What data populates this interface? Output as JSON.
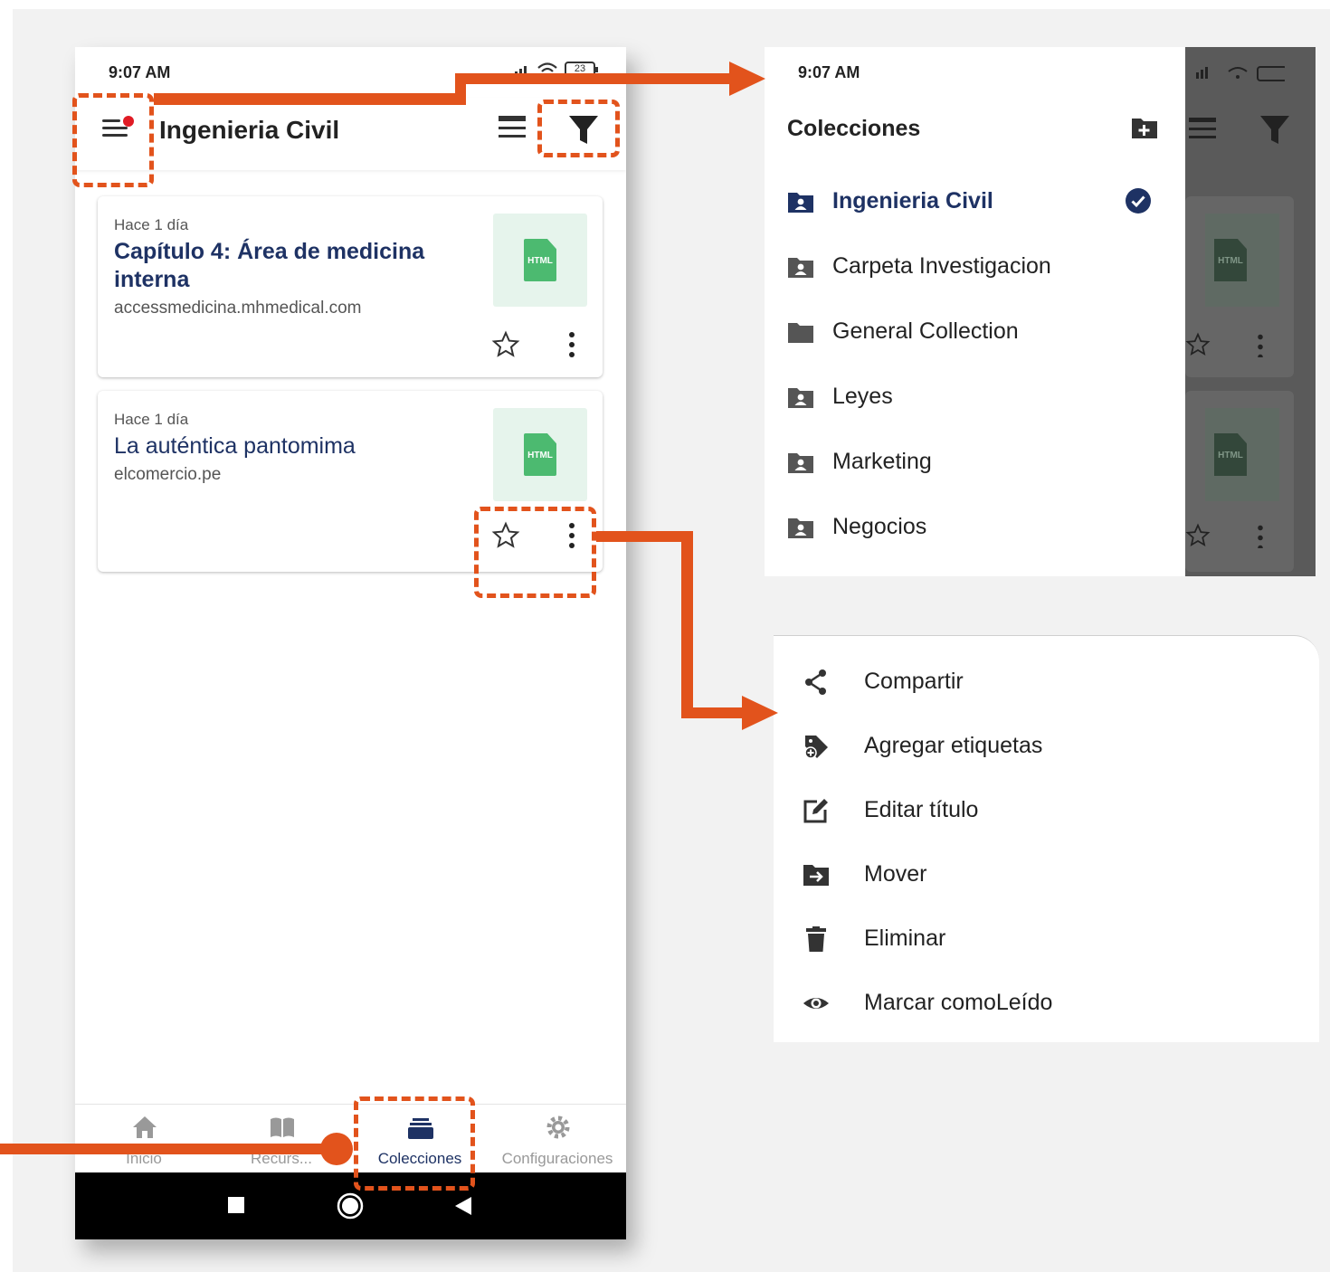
{
  "status_bar": {
    "time": "9:07 AM",
    "battery": "23"
  },
  "app_bar": {
    "title": "Ingenieria Civil"
  },
  "cards": [
    {
      "meta": "Hace 1 día",
      "title": "Capítulo 4: Área de medicina interna",
      "domain": "accessmedicina.mhmedical.com",
      "file_type": "HTML"
    },
    {
      "meta": "Hace 1 día",
      "title": "La auténtica pantomima",
      "domain": "elcomercio.pe",
      "file_type": "HTML"
    }
  ],
  "bottom_nav": [
    {
      "label": "Inicio",
      "icon": "home-icon"
    },
    {
      "label": "Recurs...",
      "icon": "book-icon"
    },
    {
      "label": "Colecciones",
      "icon": "collections-icon",
      "active": true
    },
    {
      "label": "Configuraciones",
      "icon": "gear-icon"
    }
  ],
  "drawer": {
    "time": "9:07 AM",
    "title": "Colecciones",
    "ghost_file_type": "HTML",
    "collections": [
      {
        "label": "Ingenieria Civil",
        "selected": true,
        "icon": "shared-folder-icon"
      },
      {
        "label": "Carpeta Investigacion",
        "icon": "shared-folder-icon"
      },
      {
        "label": "General Collection",
        "icon": "folder-icon"
      },
      {
        "label": "Leyes",
        "icon": "shared-folder-icon"
      },
      {
        "label": "Marketing",
        "icon": "shared-folder-icon"
      },
      {
        "label": "Negocios",
        "icon": "shared-folder-icon"
      }
    ]
  },
  "context_menu": [
    {
      "label": "Compartir",
      "icon": "share-icon"
    },
    {
      "label": "Agregar etiquetas",
      "icon": "add-tag-icon"
    },
    {
      "label": "Editar título",
      "icon": "edit-icon"
    },
    {
      "label": "Mover",
      "icon": "move-folder-icon"
    },
    {
      "label": "Eliminar",
      "icon": "trash-icon"
    },
    {
      "label": "Marcar comoLeído",
      "icon": "eye-icon"
    }
  ],
  "colors": {
    "accent_dark": "#1e3264",
    "annotation": "#e2531c",
    "html_green": "#4cba70"
  }
}
